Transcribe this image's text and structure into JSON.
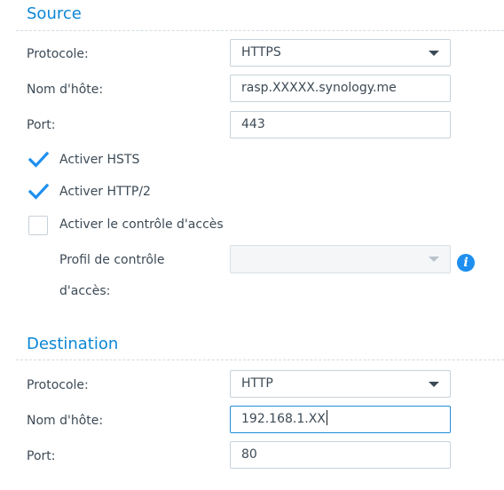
{
  "source": {
    "title": "Source",
    "protocol": {
      "label": "Protocole:",
      "value": "HTTPS"
    },
    "hostname": {
      "label": "Nom d'hôte:",
      "value": "rasp.XXXXX.synology.me"
    },
    "port": {
      "label": "Port:",
      "value": "443"
    },
    "hsts": {
      "label": "Activer HSTS",
      "checked": true
    },
    "http2": {
      "label": "Activer HTTP/2",
      "checked": true
    },
    "access_control": {
      "label": "Activer le contrôle d'accès",
      "checked": false
    },
    "access_profile": {
      "label_line1": "Profil de contrôle",
      "label_line2": "d'accès:",
      "value": "",
      "disabled": true,
      "info_icon": "info-icon"
    }
  },
  "destination": {
    "title": "Destination",
    "protocol": {
      "label": "Protocole:",
      "value": "HTTP"
    },
    "hostname": {
      "label": "Nom d'hôte:",
      "value": "192.168.1.XX"
    },
    "port": {
      "label": "Port:",
      "value": "80"
    }
  },
  "colors": {
    "accent": "#0a86d6",
    "check": "#1e8ff0",
    "text": "#3c4a56",
    "border": "#c8d1d9"
  }
}
